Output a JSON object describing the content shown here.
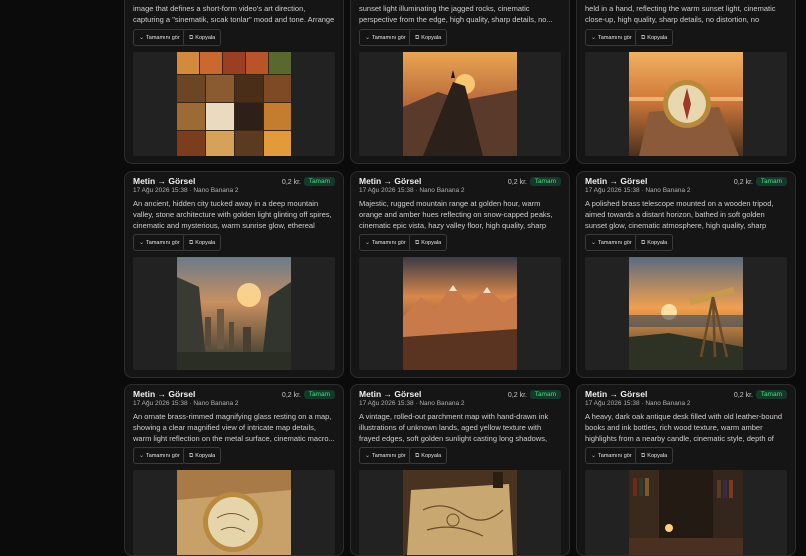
{
  "common": {
    "expand_label": "Tamamını gör",
    "copy_label": "Kopyala",
    "title": "Metin → Görsel",
    "meta": "17 Ağu 2026 15:38 · Nano Banana 2",
    "price": "0,2 kr.",
    "status": "Tamam",
    "status_color": "#4ade80"
  },
  "cards": [
    {
      "text": "image that defines a short-form video's art direction, capturing a \"sinematik, sıcak tonlar\" mood and tone. Arrange a balance...",
      "icon": "coffee-moodboard-image"
    },
    {
      "text": "sunset light illuminating the jagged rocks, cinematic perspective from the edge, high quality, sharp details, no...",
      "icon": "cliff-sunset-image"
    },
    {
      "text": "held in a hand, reflecting the warm sunset light, cinematic close-up, high quality, sharp details, no distortion, no gibberi...",
      "icon": "compass-in-hand-image"
    },
    {
      "text": "An ancient, hidden city tucked away in a deep mountain valley, stone architecture with golden light glinting off spires, cinematic and mysterious, warm sunrise glow, ethereal mist,...",
      "icon": "hidden-city-image"
    },
    {
      "text": "Majestic, rugged mountain range at golden hour, warm orange and amber hues reflecting on snow-capped peaks, cinematic epic vista, hazy valley floor, high quality, sharp details, no...",
      "icon": "mountain-range-image"
    },
    {
      "text": "A polished brass telescope mounted on a wooden tripod, aimed towards a distant horizon, bathed in soft golden sunset glow, cinematic atmosphere, high quality, sharp details, no...",
      "icon": "telescope-sunset-image"
    },
    {
      "text": "An ornate brass-rimmed magnifying glass resting on a map, showing a clear magnified view of intricate map details, warm light reflection on the metal surface, cinematic macro...",
      "icon": "magnifying-glass-map-image"
    },
    {
      "text": "A vintage, rolled-out parchment map with hand-drawn ink illustrations of unknown lands, aged yellow texture with frayed edges, soft golden sunlight casting long shadows, cinematic...",
      "icon": "parchment-map-image"
    },
    {
      "text": "A heavy, dark oak antique desk filled with old leather-bound books and ink bottles, rich wood texture, warm amber highlights from a nearby candle, cinematic style, depth of fiel...",
      "icon": "antique-desk-image"
    }
  ]
}
